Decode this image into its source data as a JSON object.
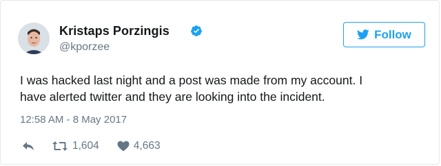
{
  "tweet": {
    "author": {
      "name": "Kristaps Porzingis",
      "handle": "@kporzee",
      "avatar_icon": "user-avatar",
      "verified_icon": "verified-badge-icon"
    },
    "follow_button": {
      "label": "Follow",
      "icon": "twitter-bird-icon"
    },
    "text_lines": [
      "I was hacked last night and a post was made from my account. I",
      "have alerted twitter and they are looking into the incident."
    ],
    "timestamp": "12:58 AM - 8 May 2017",
    "actions": {
      "reply_icon": "reply-icon",
      "retweet_icon": "retweet-icon",
      "retweet_count": "1,604",
      "like_icon": "heart-icon",
      "like_count": "4,663"
    }
  },
  "colors": {
    "accent": "#1da1f2",
    "text": "#14171a",
    "muted": "#657786",
    "border": "#e1e8ed"
  }
}
